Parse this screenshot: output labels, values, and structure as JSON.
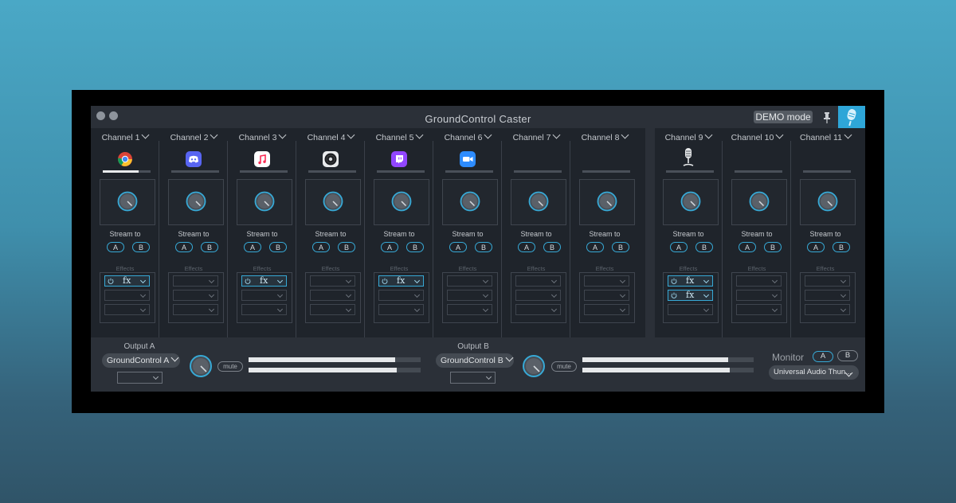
{
  "window": {
    "title": "GroundControl Caster",
    "demo_label": "DEMO mode"
  },
  "colors": {
    "accent": "#37a9d6",
    "panel": "#1f242b",
    "window": "#2b3038"
  },
  "channels": [
    {
      "label": "Channel 1",
      "app": "chrome-icon",
      "level": 0.75,
      "stream_a": "A",
      "stream_b": "B",
      "effects": [
        "fx",
        "",
        ""
      ]
    },
    {
      "label": "Channel 2",
      "app": "discord-icon",
      "level": 0,
      "stream_a": "A",
      "stream_b": "B",
      "effects": [
        "",
        "",
        ""
      ]
    },
    {
      "label": "Channel 3",
      "app": "apple-music-icon",
      "level": 0,
      "stream_a": "A",
      "stream_b": "B",
      "effects": [
        "fx",
        "",
        ""
      ]
    },
    {
      "label": "Channel 4",
      "app": "vinyl-disc-icon",
      "level": 0,
      "stream_a": "A",
      "stream_b": "B",
      "effects": [
        "",
        "",
        ""
      ]
    },
    {
      "label": "Channel 5",
      "app": "twitch-icon",
      "level": 0,
      "stream_a": "A",
      "stream_b": "B",
      "effects": [
        "fx",
        "",
        ""
      ]
    },
    {
      "label": "Channel 6",
      "app": "zoom-icon",
      "level": 0,
      "stream_a": "A",
      "stream_b": "B",
      "effects": [
        "",
        "",
        ""
      ]
    },
    {
      "label": "Channel 7",
      "app": "",
      "level": 0,
      "stream_a": "A",
      "stream_b": "B",
      "effects": [
        "",
        "",
        ""
      ]
    },
    {
      "label": "Channel 8",
      "app": "",
      "level": 0,
      "stream_a": "A",
      "stream_b": "B",
      "effects": [
        "",
        "",
        ""
      ]
    },
    {
      "label": "Channel 9",
      "app": "microphone-icon",
      "level": 0,
      "stream_a": "A",
      "stream_b": "B",
      "effects": [
        "fx",
        "fx",
        ""
      ]
    },
    {
      "label": "Channel 10",
      "app": "",
      "level": 0,
      "stream_a": "A",
      "stream_b": "B",
      "effects": [
        "",
        "",
        ""
      ]
    },
    {
      "label": "Channel 11",
      "app": "",
      "level": 0,
      "stream_a": "A",
      "stream_b": "B",
      "effects": [
        "",
        "",
        ""
      ]
    }
  ],
  "strip_labels": {
    "stream_to": "Stream to",
    "effects": "Effects"
  },
  "output_a": {
    "label": "Output A",
    "device": "GroundControl A",
    "mute": "mute",
    "level_l": 0.85,
    "level_r": 0.86
  },
  "output_b": {
    "label": "Output B",
    "device": "GroundControl B",
    "mute": "mute",
    "level_l": 0.85,
    "level_r": 0.86
  },
  "monitor": {
    "label": "Monitor",
    "a": "A",
    "b": "B",
    "device": "Universal Audio Thun..."
  }
}
